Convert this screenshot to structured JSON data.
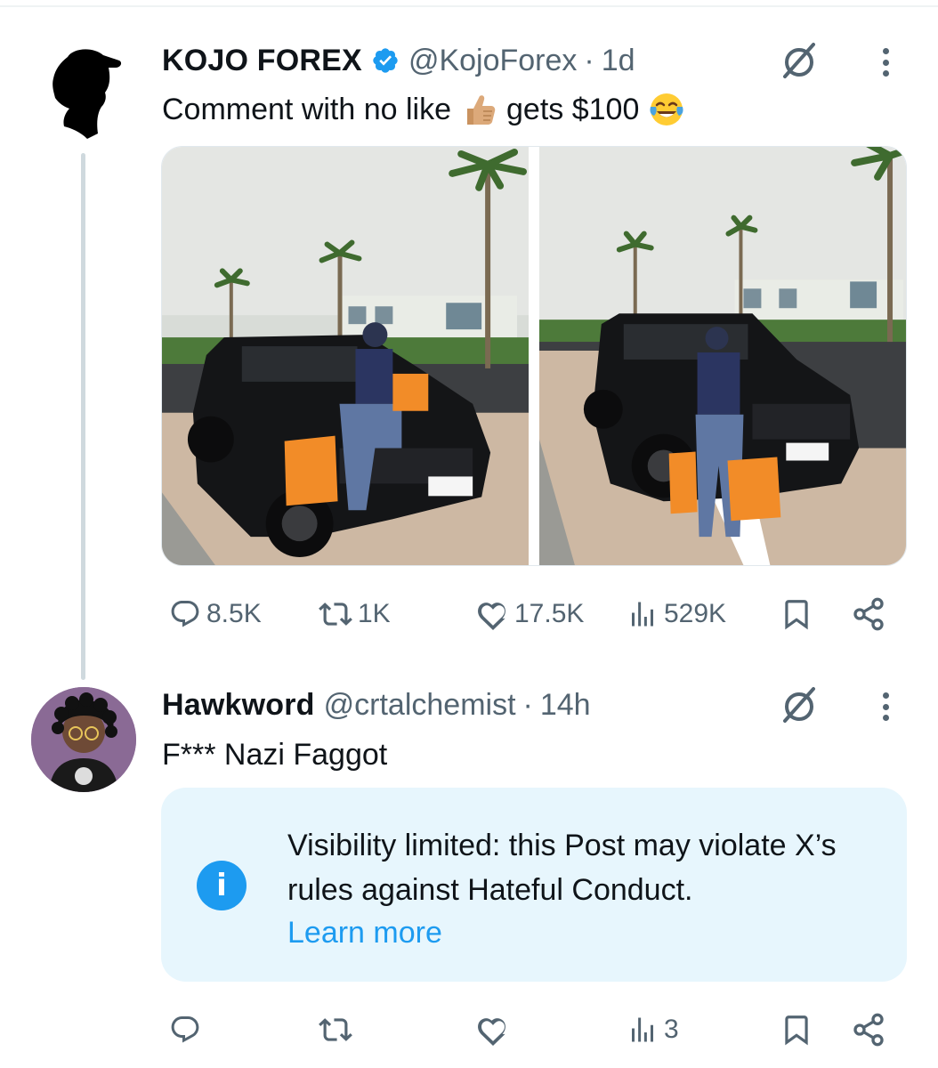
{
  "thread": [
    {
      "author": {
        "name": "KOJO FOREX",
        "handle": "@KojoForex",
        "verified": true
      },
      "time": "1d",
      "separator": "·",
      "text_before": "Comment with no like",
      "text_middle": "gets $100",
      "emojis": [
        "thumbs-up",
        "tears-of-joy"
      ],
      "media_count": 2,
      "stats": {
        "replies": "8.5K",
        "reposts": "1K",
        "likes": "17.5K",
        "views": "529K"
      }
    },
    {
      "author": {
        "name": "Hawkword",
        "handle": "@crtalchemist",
        "verified": false
      },
      "time": "14h",
      "separator": "·",
      "text": "F*** Nazi Faggot",
      "notice": {
        "text": "Visibility limited: this Post may violate X’s rules against Hateful Conduct.",
        "link": "Learn more",
        "icon": "i"
      },
      "stats": {
        "replies": "",
        "reposts": "",
        "likes": "",
        "views": "3"
      }
    }
  ],
  "colors": {
    "accent": "#1d9bf0",
    "muted": "#536471",
    "notice_bg": "#e7f6fd",
    "text": "#0f1419"
  }
}
